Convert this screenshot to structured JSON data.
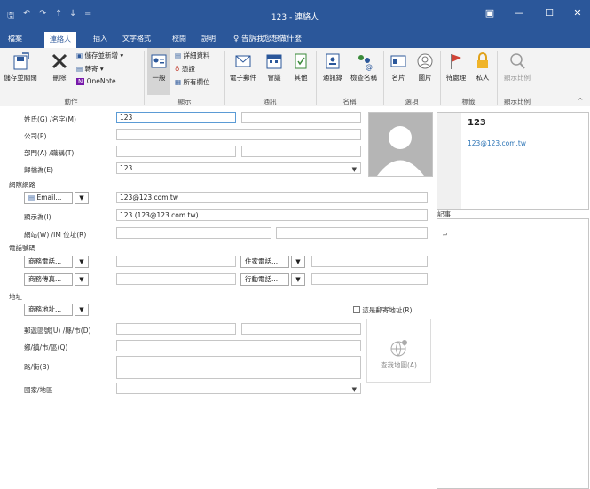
{
  "titlebar": {
    "title": "123 - 連絡人",
    "minimize": "—",
    "restore": "☐",
    "close": "✕",
    "ribbon_display": "▣"
  },
  "quickaccess": {
    "save": "🖫",
    "undo": "↶",
    "redo": "↷",
    "up": "↑",
    "down": "↓",
    "customize": "="
  },
  "tabs": [
    "檔案",
    "連絡人",
    "插入",
    "文字格式",
    "校閱",
    "說明"
  ],
  "tellme": "告訴我您想做什麼",
  "ribbon": {
    "save_close": "儲存並關閉",
    "delete": "刪除",
    "save_new": "儲存並新增",
    "forward": "轉寄",
    "onenote": "OneNote",
    "group_actions": "動作",
    "general": "一般",
    "details": "詳細資料",
    "certificates": "憑證",
    "all_fields": "所有欄位",
    "group_show": "顯示",
    "email": "電子郵件",
    "meeting": "會議",
    "more": "其他",
    "group_communicate": "通訊",
    "address_book": "通訊錄",
    "check_names": "檢查名稱",
    "group_names": "名稱",
    "business_card": "名片",
    "picture": "圖片",
    "group_options": "選項",
    "follow_up": "待處理",
    "private": "私人",
    "group_tags": "標籤",
    "zoom": "顯示比例",
    "group_zoom": "顯示比例"
  },
  "form": {
    "name_label": "姓氏(G) /名字(M)",
    "last_name": "123",
    "company_label": "公司(P)",
    "department_label": "部門(A) /職稱(T)",
    "file_as_label": "歸檔為(E)",
    "file_as": "123",
    "internet_header": "網際網路",
    "email_button": "Email...",
    "email_value": "123@123.com.tw",
    "display_as_label": "顯示為(I)",
    "display_as": "123 (123@123.com.tw)",
    "webpage_label": "網站(W) /IM 位址(R)",
    "phone_header": "電話號碼",
    "business_phone": "商務電話...",
    "home_phone": "住家電話...",
    "business_fax": "商務傳真...",
    "mobile_phone": "行動電話...",
    "address_header": "地址",
    "business_address": "商務地址...",
    "mailing_address_label": "這是郵寄地址(R)",
    "zip_label": "郵遞區號(U) /縣/市(D)",
    "town_label": "鄉/鎮/市/區(Q)",
    "street_label": "路/街(B)",
    "country_label": "國家/地區",
    "map_it": "查我地圖(A)",
    "dropdown_arrow": "▼"
  },
  "card": {
    "name": "123",
    "email": "123@123.com.tw"
  },
  "notes": {
    "label": "記事",
    "mark": "↵"
  },
  "colors": {
    "titlebar": "#2b579a",
    "ribbon": "#f3f3f3",
    "link": "#2e75b6"
  }
}
